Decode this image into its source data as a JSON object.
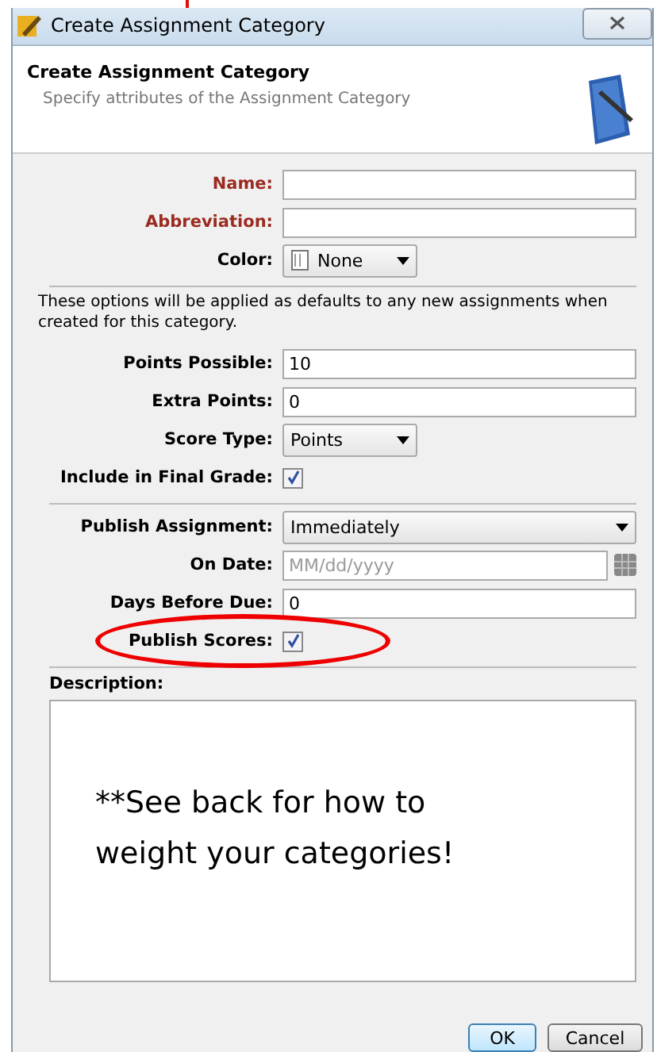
{
  "window": {
    "title": "Create Assignment Category"
  },
  "header": {
    "title": "Create Assignment Category",
    "subtitle": "Specify attributes of the Assignment Category"
  },
  "fields_top": [
    {
      "label": "Name:",
      "kind": "text",
      "required": true
    },
    {
      "label": "Abbreviation:",
      "kind": "text",
      "required": true
    },
    {
      "label": "Color:",
      "kind": "select",
      "value": "None",
      "required": false
    }
  ],
  "note": "These options will be applied as defaults to any new assignments when created for this category.",
  "fields_defaults": [
    {
      "label": "Points Possible:",
      "kind": "text",
      "value": "10",
      "required": false
    },
    {
      "label": "Extra Points:",
      "kind": "text",
      "value": "0",
      "required": false
    },
    {
      "label": "Score Type:",
      "kind": "select",
      "value": "Points",
      "required": false
    },
    {
      "label": "Include in Final Grade:",
      "kind": "checkbox",
      "checked": true,
      "required": false
    }
  ],
  "fields_publish": [
    {
      "label": "Publish Assignment:",
      "kind": "combo",
      "value": "Immediately",
      "required": false
    },
    {
      "label": "On Date:",
      "kind": "date",
      "placeholder": "MM/dd/yyyy",
      "required": false
    },
    {
      "label": "Days Before Due:",
      "kind": "text",
      "value": "0",
      "required": false
    },
    {
      "label": "Publish Scores:",
      "kind": "checkbox",
      "checked": true,
      "required": false,
      "circled": true
    }
  ],
  "description": {
    "label": "Description:",
    "value": "**See back for how to weight your categories!"
  },
  "buttons": [
    {
      "label": "OK",
      "default": true
    },
    {
      "label": "Cancel",
      "default": false
    }
  ]
}
